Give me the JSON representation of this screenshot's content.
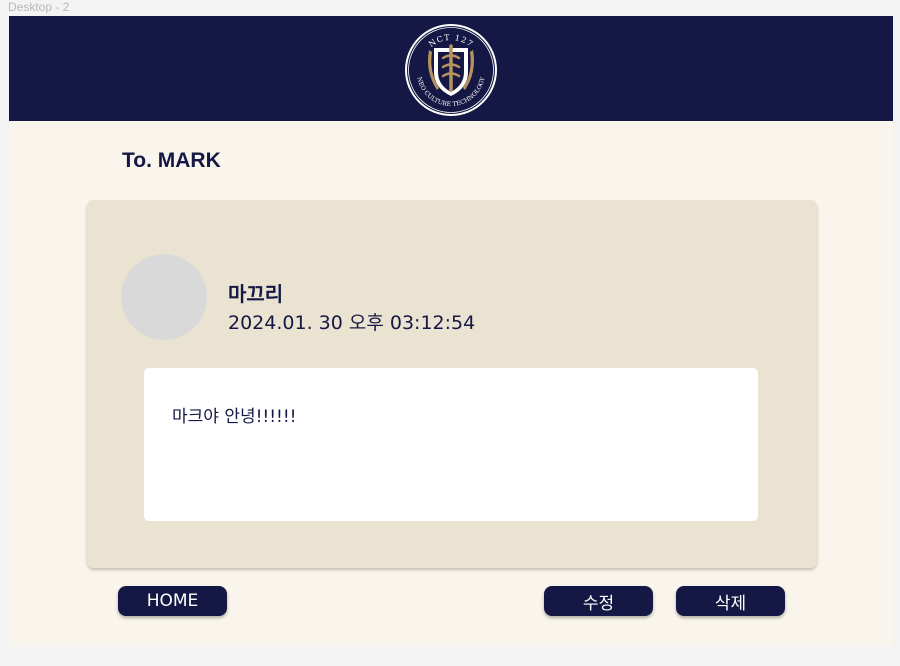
{
  "frame": {
    "label": "Desktop - 2"
  },
  "header": {
    "logo": {
      "icon": "nct-127-crest-logo",
      "text_top": "NCT 127",
      "text_bottom": "NEO CULTURE TECHNOLOGY"
    }
  },
  "page": {
    "title": "To. MARK"
  },
  "post": {
    "author": "마끄리",
    "timestamp": "2024.01. 30 오후 03:12:54",
    "message": "마크야 안녕!!!!!!"
  },
  "buttons": {
    "home": "HOME",
    "edit": "수정",
    "delete": "삭제"
  },
  "colors": {
    "navy": "#151844",
    "background": "#f9f5ec",
    "card": "#ebe3d2",
    "gold": "#b8925c",
    "avatar": "#d9d9d9"
  }
}
